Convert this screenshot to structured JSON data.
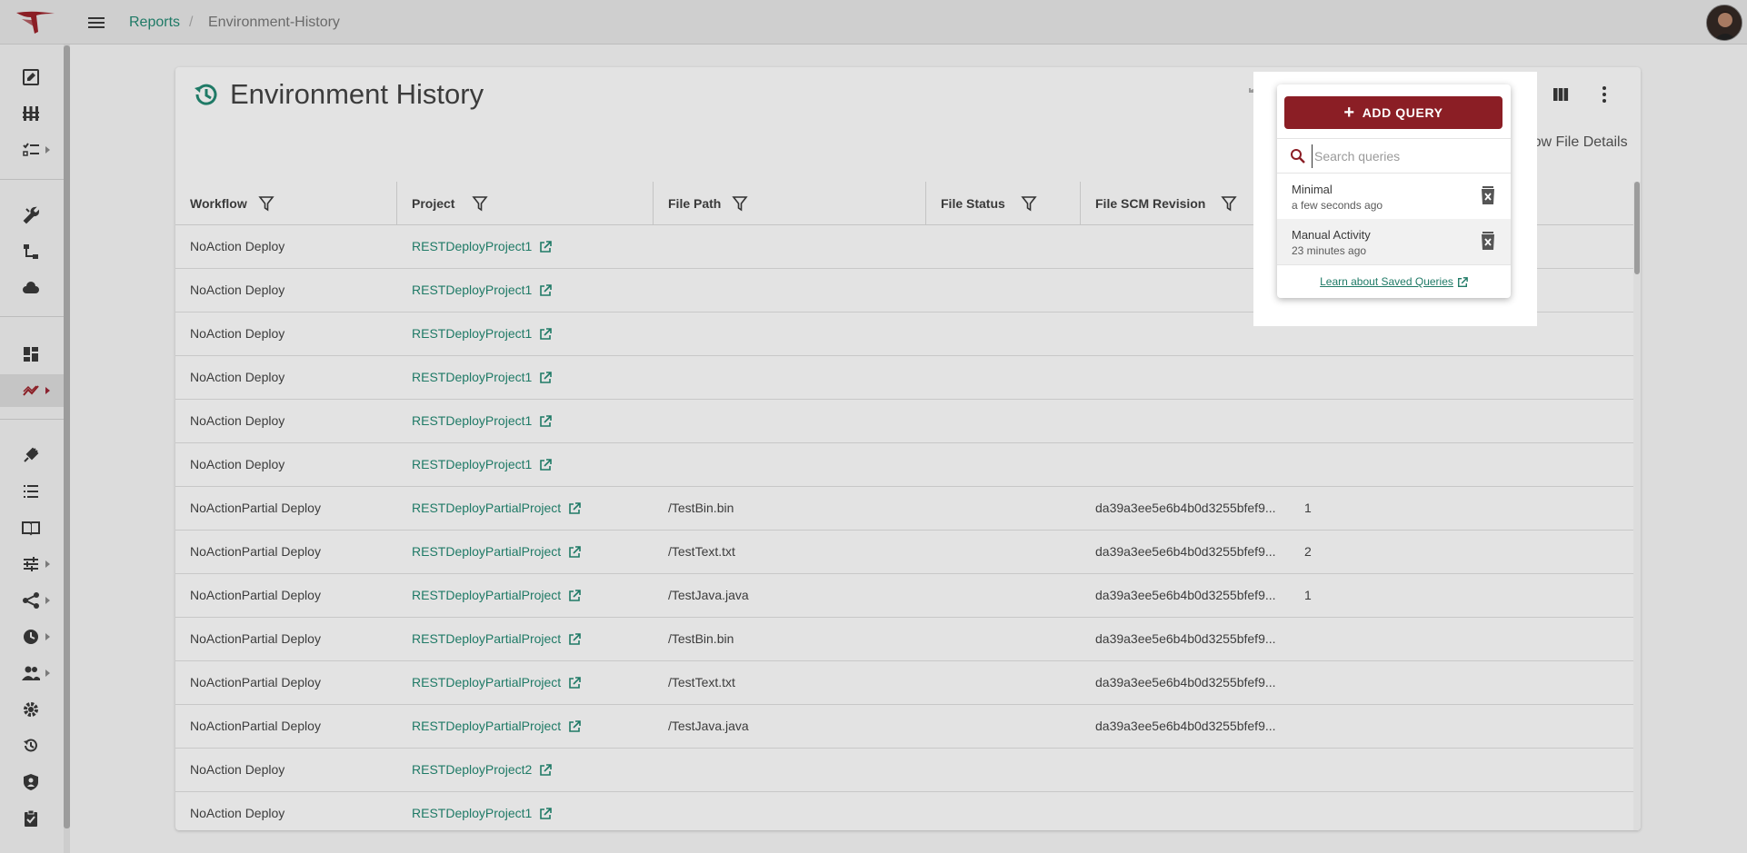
{
  "breadcrumb": {
    "parent": "Reports",
    "separator": "/",
    "current": "Environment-History"
  },
  "page": {
    "title": "Environment History",
    "show_file_details": "Show File Details"
  },
  "table": {
    "columns": [
      "Workflow",
      "Project",
      "File Path",
      "File Status",
      "File SCM Revision"
    ],
    "rows": [
      [
        "NoAction Deploy",
        "RESTDeployProject1",
        "",
        "",
        "",
        ""
      ],
      [
        "NoAction Deploy",
        "RESTDeployProject1",
        "",
        "",
        "",
        ""
      ],
      [
        "NoAction Deploy",
        "RESTDeployProject1",
        "",
        "",
        "",
        ""
      ],
      [
        "NoAction Deploy",
        "RESTDeployProject1",
        "",
        "",
        "",
        ""
      ],
      [
        "NoAction Deploy",
        "RESTDeployProject1",
        "",
        "",
        "",
        ""
      ],
      [
        "NoAction Deploy",
        "RESTDeployProject1",
        "",
        "",
        "",
        ""
      ],
      [
        "NoActionPartial Deploy",
        "RESTDeployPartialProject",
        "/TestBin.bin",
        "",
        "da39a3ee5e6b4b0d3255bfef9...",
        "1"
      ],
      [
        "NoActionPartial Deploy",
        "RESTDeployPartialProject",
        "/TestText.txt",
        "",
        "da39a3ee5e6b4b0d3255bfef9...",
        "2"
      ],
      [
        "NoActionPartial Deploy",
        "RESTDeployPartialProject",
        "/TestJava.java",
        "",
        "da39a3ee5e6b4b0d3255bfef9...",
        "1"
      ],
      [
        "NoActionPartial Deploy",
        "RESTDeployPartialProject",
        "/TestBin.bin",
        "",
        "da39a3ee5e6b4b0d3255bfef9...",
        ""
      ],
      [
        "NoActionPartial Deploy",
        "RESTDeployPartialProject",
        "/TestText.txt",
        "",
        "da39a3ee5e6b4b0d3255bfef9...",
        ""
      ],
      [
        "NoActionPartial Deploy",
        "RESTDeployPartialProject",
        "/TestJava.java",
        "",
        "da39a3ee5e6b4b0d3255bfef9...",
        ""
      ],
      [
        "NoAction Deploy",
        "RESTDeployProject2",
        "",
        "",
        "",
        ""
      ],
      [
        "NoAction Deploy",
        "RESTDeployProject1",
        "",
        "",
        "",
        ""
      ]
    ]
  },
  "queries_popup": {
    "add_label": "ADD QUERY",
    "search_placeholder": "Search queries",
    "items": [
      {
        "name": "Minimal",
        "time": "a few seconds ago"
      },
      {
        "name": "Manual Activity",
        "time": "23 minutes ago"
      }
    ],
    "learn_link": "Learn about Saved Queries"
  },
  "sidebar": {
    "icons": [
      "edit-icon",
      "pipelines-icon",
      "checklist-icon",
      "tools-icon",
      "workflow-icon",
      "cloud-icon",
      "dashboard-icon",
      "reports-icon",
      "plugin-icon",
      "list-icon",
      "book-icon",
      "sliders-icon",
      "network-icon",
      "clock-icon",
      "users-icon",
      "settings-icon",
      "history-icon",
      "shield-icon",
      "approvals-icon"
    ]
  },
  "colors": {
    "accent": "#1f7a66",
    "brand": "#8b1e25"
  }
}
